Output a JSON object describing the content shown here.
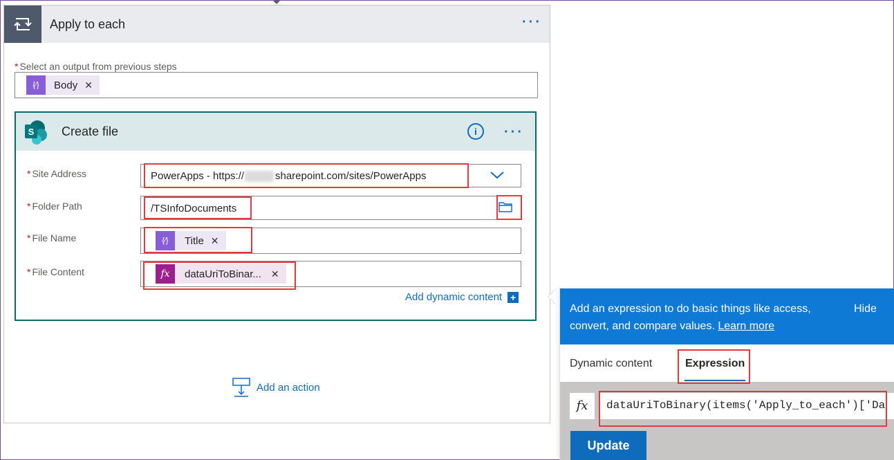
{
  "loop": {
    "title": "Apply to each",
    "more_icon": "more-dots-icon",
    "select_label": "Select an output from previous steps",
    "select_token": "Body"
  },
  "create_file": {
    "title": "Create file",
    "info_icon": "info-icon",
    "site_label": "Site Address",
    "site_value_prefix": "PowerApps - https://",
    "site_value_suffix": "sharepoint.com/sites/PowerApps",
    "folder_label": "Folder Path",
    "folder_value": "/TSInfoDocuments",
    "filename_label": "File Name",
    "filename_token": "Title",
    "filecontent_label": "File Content",
    "filecontent_token": "dataUriToBinar...",
    "add_dynamic": "Add dynamic content"
  },
  "add_action": "Add an action",
  "expression_panel": {
    "help_text": "Add an expression to do basic things like access, convert, and compare values.",
    "learn_more": "Learn more",
    "hide": "Hide",
    "tab_dynamic": "Dynamic content",
    "tab_expression": "Expression",
    "fx_label": "fx",
    "expression_value": "dataUriToBinary(items('Apply_to_each')['Da",
    "update_button": "Update"
  },
  "colors": {
    "accent": "#0f6cbd",
    "panel_blue": "#0f7ad6",
    "highlight_red": "#e0393e",
    "sharepoint_teal": "#036c70",
    "token_purple": "#8a5dd8",
    "expression_magenta": "#9c1f8f"
  }
}
